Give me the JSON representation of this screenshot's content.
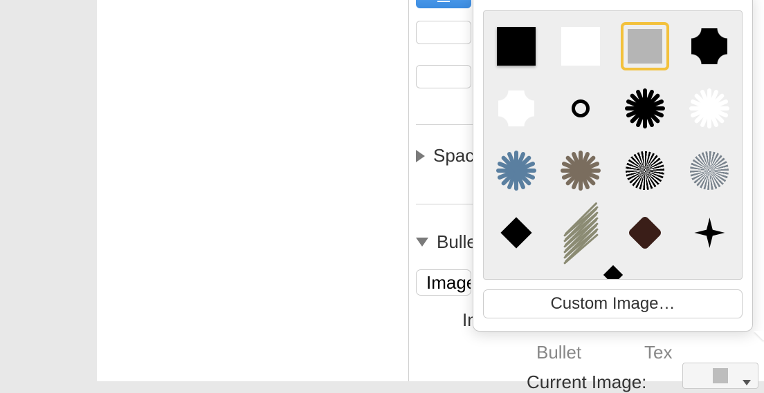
{
  "inspector": {
    "spacing_section": "Spac",
    "bullets_section": "Bulle",
    "image_dropdown_value": "Image",
    "indent_label": "In",
    "bullet_label": "Bullet",
    "text_label": "Tex",
    "current_image_label": "Current Image:"
  },
  "popover": {
    "custom_image_button": "Custom Image…",
    "bullets": [
      {
        "id": "square-black",
        "name": "black-square"
      },
      {
        "id": "square-white",
        "name": "white-square"
      },
      {
        "id": "square-gray",
        "name": "gray-square",
        "selected": true
      },
      {
        "id": "squircle-black",
        "name": "black-squircle"
      },
      {
        "id": "squircle-white",
        "name": "white-squircle"
      },
      {
        "id": "circle-outline",
        "name": "circle-outline"
      },
      {
        "id": "burst-black",
        "name": "black-burst"
      },
      {
        "id": "burst-white",
        "name": "white-burst"
      },
      {
        "id": "burst-blue",
        "name": "blue-burst"
      },
      {
        "id": "burst-brown",
        "name": "brown-burst"
      },
      {
        "id": "sunburst-black",
        "name": "black-sunburst"
      },
      {
        "id": "sunburst-gray",
        "name": "gray-sunburst"
      },
      {
        "id": "diamond-black",
        "name": "black-diamond"
      },
      {
        "id": "scribble",
        "name": "scribble-diamond"
      },
      {
        "id": "diamond-brown",
        "name": "brown-diamond"
      },
      {
        "id": "fourpoint-black",
        "name": "four-point-star"
      }
    ],
    "burst_colors": {
      "black": "#000000",
      "white": "#ffffff",
      "blue": "#5a7fa0",
      "brown": "#7a6d5e"
    },
    "sunburst_colors": {
      "black": "#000000",
      "gray": "#7a848e"
    }
  }
}
